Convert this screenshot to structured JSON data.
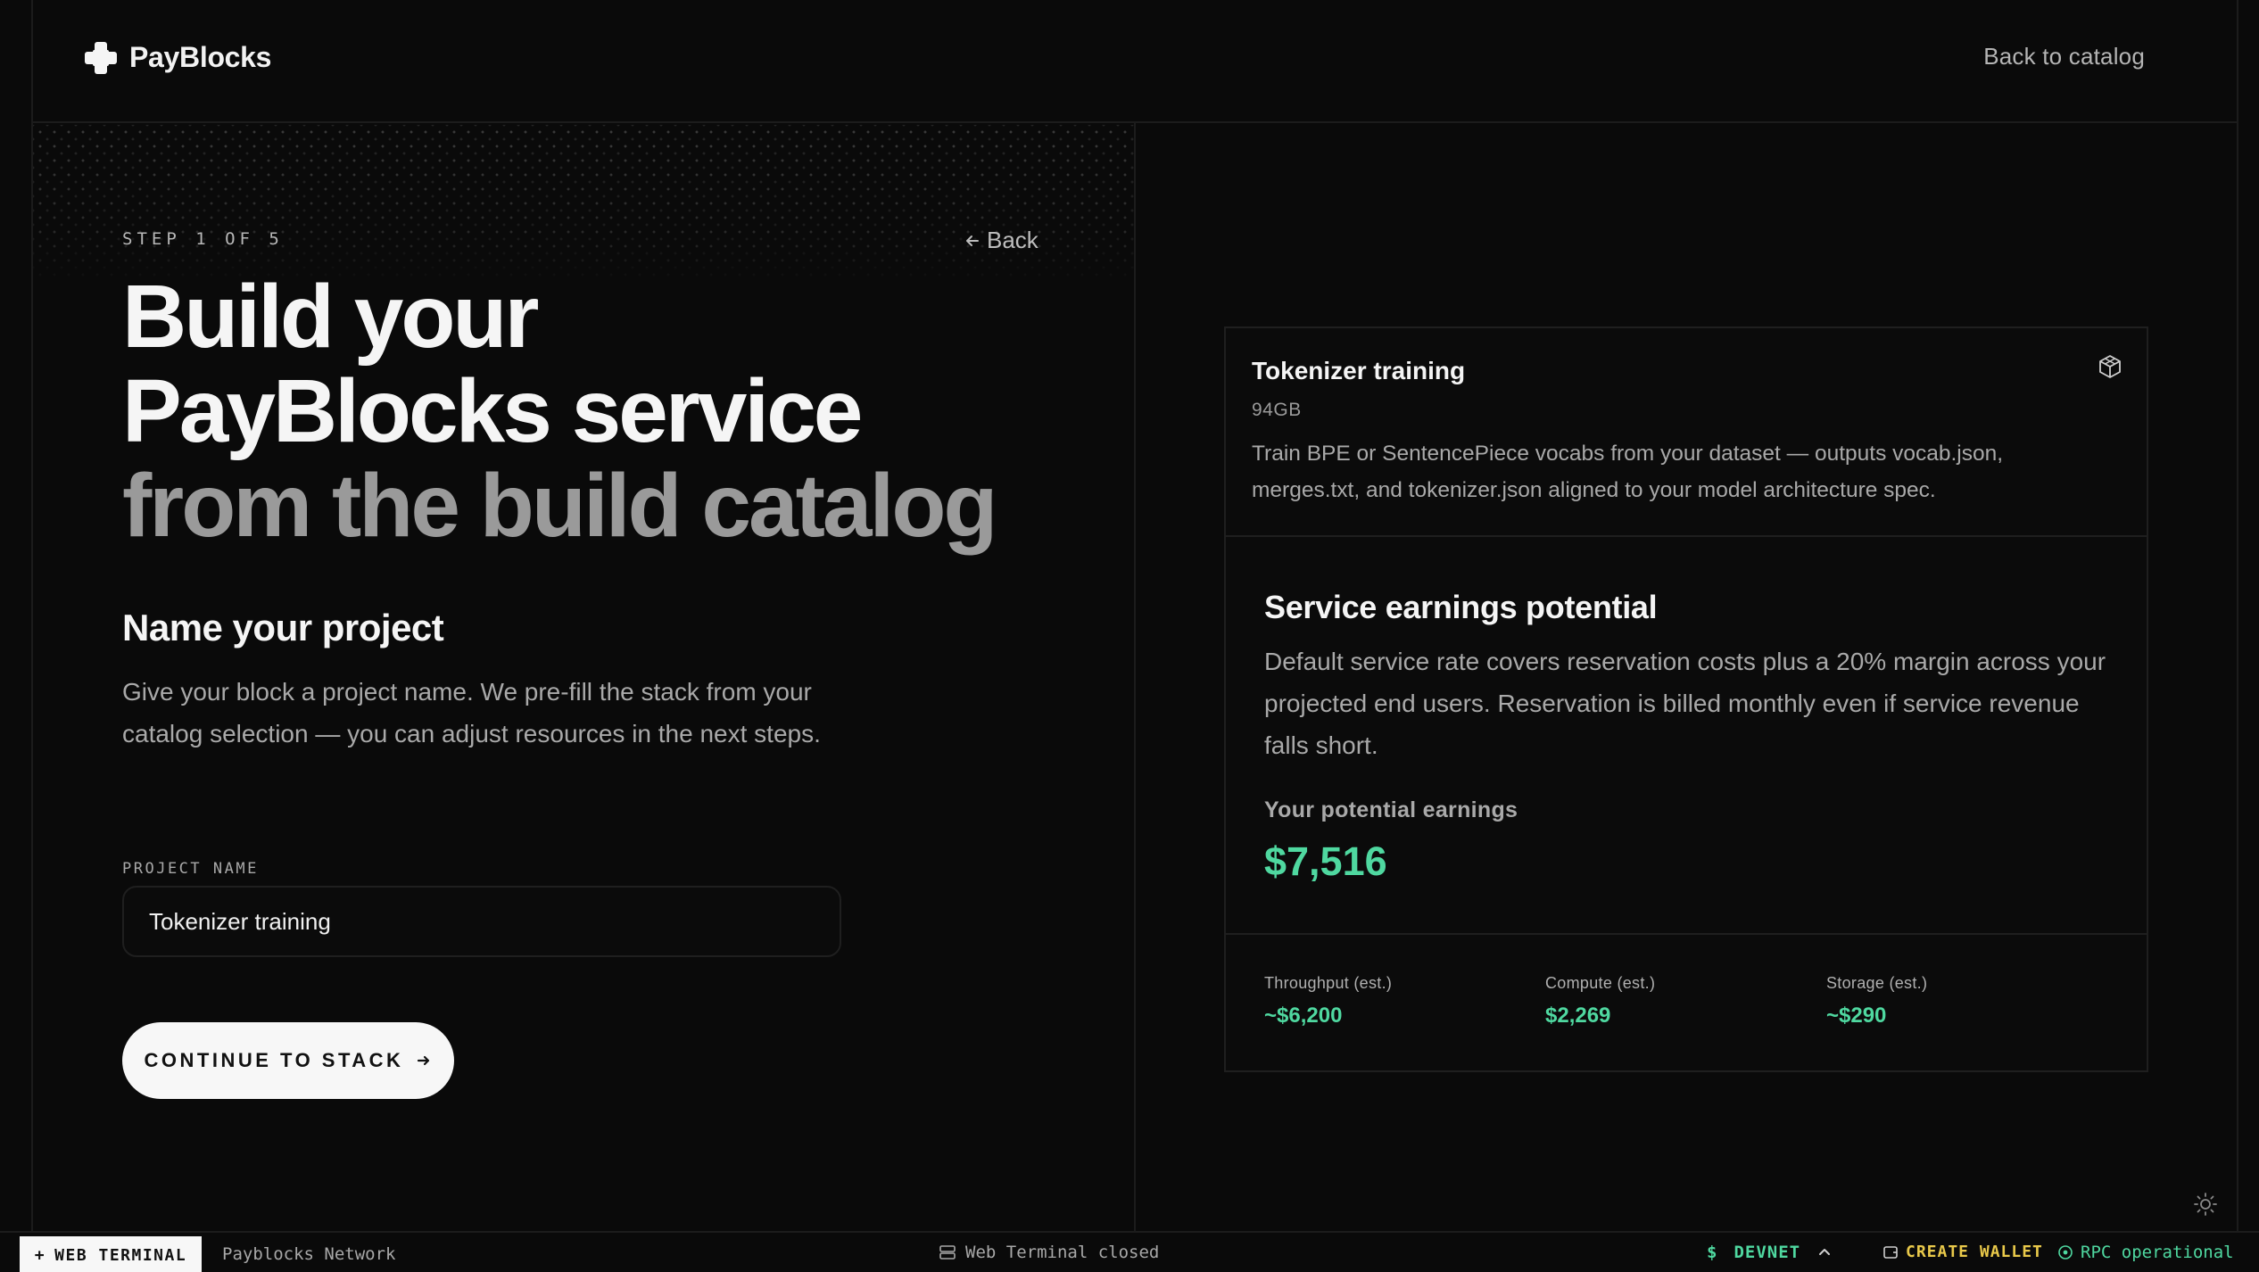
{
  "header": {
    "brand": "PayBlocks",
    "back_to_catalog": "Back to catalog"
  },
  "wizard": {
    "step": "STEP 1 OF 5",
    "back": "Back",
    "hero_line1": "Build your",
    "hero_line2": "PayBlocks service",
    "hero_line3": "from the build catalog",
    "section_title": "Name your project",
    "section_desc": "Give your block a project name. We pre-fill the stack from your catalog selection — you can adjust resources in the next steps.",
    "field_label": "PROJECT NAME",
    "field_value": "Tokenizer training",
    "cta": "CONTINUE TO STACK"
  },
  "card": {
    "title": "Tokenizer training",
    "size": "94GB",
    "description": "Train BPE or SentencePiece vocabs from your dataset — outputs vocab.json, merges.txt, and tokenizer.json aligned to your model architecture spec.",
    "icon": "cube-icon"
  },
  "earnings": {
    "title": "Service earnings potential",
    "description": "Default service rate covers reservation costs plus a 20% margin across your projected end users. Reservation is billed monthly even if service revenue falls short.",
    "label": "Your potential earnings",
    "value": "$7,516",
    "stats": [
      {
        "label": "Throughput (est.)",
        "value": "~$6,200"
      },
      {
        "label": "Compute (est.)",
        "value": "$2,269"
      },
      {
        "label": "Storage (est.)",
        "value": "~$290"
      }
    ]
  },
  "statusbar": {
    "terminal_button": "WEB TERMINAL",
    "network": "Payblocks Network",
    "terminal_status": "Web Terminal closed",
    "cluster": "DEVNET",
    "create_wallet": "CREATE WALLET",
    "rpc": "RPC operational"
  },
  "colors": {
    "accent_green": "#4fd8a0",
    "accent_yellow": "#e9c94a",
    "background": "#0a0a0a"
  }
}
